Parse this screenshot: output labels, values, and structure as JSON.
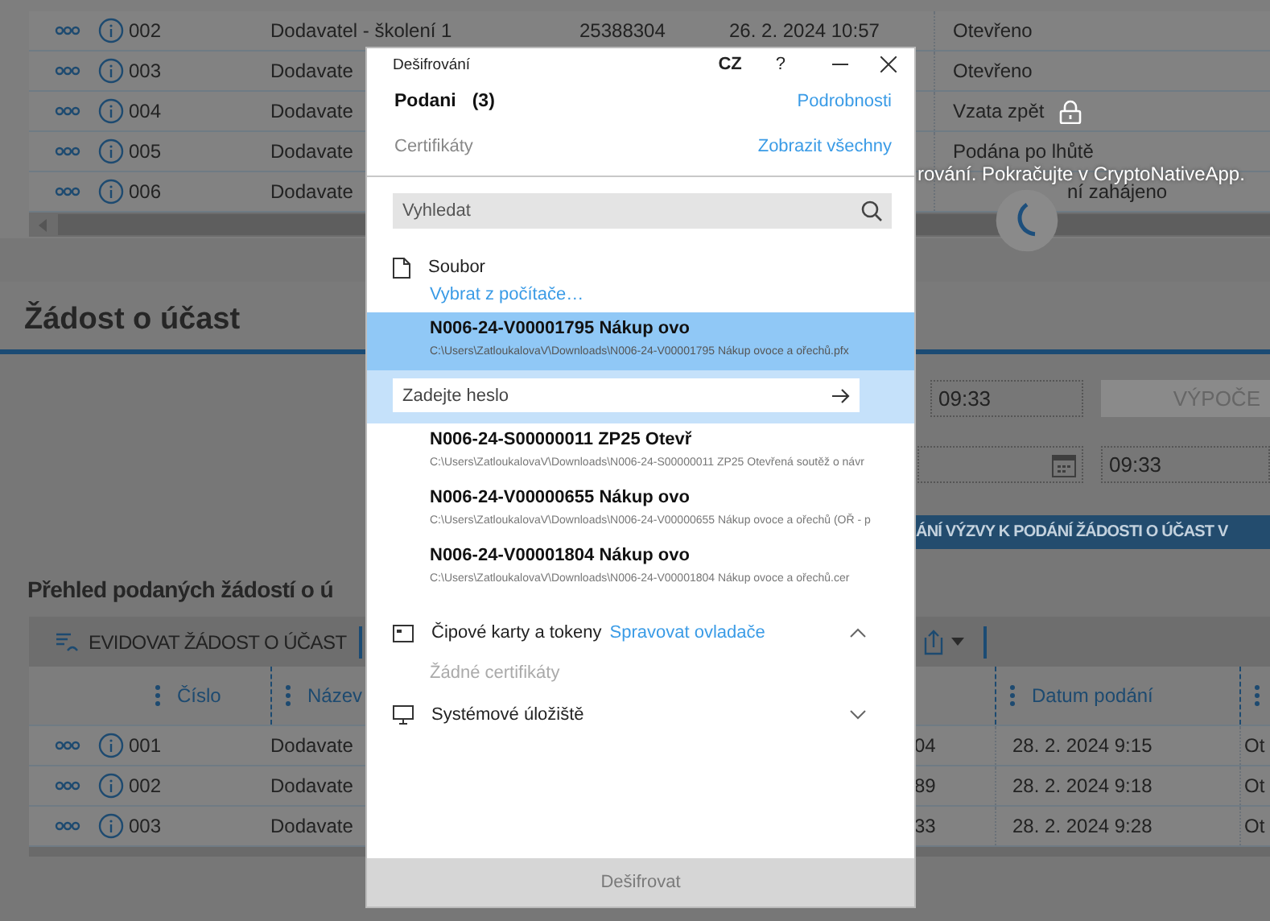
{
  "top_table": {
    "rows": [
      {
        "number": "002",
        "name": "Dodavatel - školení 1",
        "code": "25388304",
        "date": "26. 2. 2024 10:57",
        "status": "Otevřeno"
      },
      {
        "number": "003",
        "name": "Dodavate",
        "status": "Otevřeno"
      },
      {
        "number": "004",
        "name": "Dodavate",
        "status": "Vzata zpět"
      },
      {
        "number": "005",
        "name": "Dodavate",
        "status": "Podána po lhůtě"
      },
      {
        "number": "006",
        "name": "Dodavate",
        "status": "ní zahájeno"
      }
    ]
  },
  "section_title": "Žádost o účast",
  "form": {
    "time_1": "09:33",
    "calc_button": "VÝPOČE",
    "time_2": "09:33",
    "banner": "ÁNÍ VÝZVY K PODÁNÍ ŽÁDOSTI O ÚČAST V"
  },
  "requests": {
    "title": "Přehled podaných žádostí o ú",
    "add_button": "EVIDOVAT ŽÁDOST O ÚČAST",
    "columns": [
      {
        "label": "Číslo"
      },
      {
        "label": "Název"
      },
      {
        "label": "Datum podání"
      }
    ],
    "rows": [
      {
        "number": "001",
        "name": "Dodavate",
        "column_4": "04",
        "date": "28. 2. 2024 9:15",
        "status": "Ot"
      },
      {
        "number": "002",
        "name": "Dodavate",
        "column_4": "89",
        "date": "28. 2. 2024 9:18",
        "status": "Ot"
      },
      {
        "number": "003",
        "name": "Dodavate",
        "column_4": "33",
        "date": "28. 2. 2024 9:28",
        "status": "Ot"
      }
    ]
  },
  "notice": "rování. Pokračujte v CryptoNativeApp.",
  "dialog": {
    "title": "Dešifrování",
    "language": "CZ",
    "help": "?",
    "heading": "Podani",
    "count": "(3)",
    "details_link": "Podrobnosti",
    "certs_label": "Certifikáty",
    "show_all_link": "Zobrazit všechny",
    "search": {
      "placeholder": "Vyhledat"
    },
    "password": {
      "placeholder": "Zadejte heslo"
    },
    "sections": [
      {
        "kind": "file",
        "label": "Soubor",
        "link": "Vybrat z počítače…",
        "items": [
          {
            "title": "N006-24-V00001795 Nákup ovo",
            "path": "C:\\Users\\ZatloukalovaV\\Downloads\\N006-24-V00001795 Nákup ovoce a ořechů.pfx",
            "selected": true
          },
          {
            "title": "N006-24-S00000011 ZP25 Otevř",
            "path": "C:\\Users\\ZatloukalovaV\\Downloads\\N006-24-S00000011 ZP25 Otevřená soutěž o návr",
            "selected": false
          },
          {
            "title": "N006-24-V00000655 Nákup ovo",
            "path": "C:\\Users\\ZatloukalovaV\\Downloads\\N006-24-V00000655 Nákup ovoce a ořechů (OŘ - p",
            "selected": false
          },
          {
            "title": "N006-24-V00001804 Nákup ovo",
            "path": "C:\\Users\\ZatloukalovaV\\Downloads\\N006-24-V00001804 Nákup ovoce a ořechů.cer",
            "selected": false
          }
        ]
      },
      {
        "kind": "smartcard",
        "label": "Čipové karty a tokeny",
        "link": "Spravovat ovladače",
        "expanded": true,
        "empty_text": "Žádné certifikáty"
      },
      {
        "kind": "system",
        "label": "Systémové úložiště",
        "expanded": false
      }
    ],
    "decrypt_button": {
      "label": "Dešifrovat",
      "disabled": true
    }
  }
}
